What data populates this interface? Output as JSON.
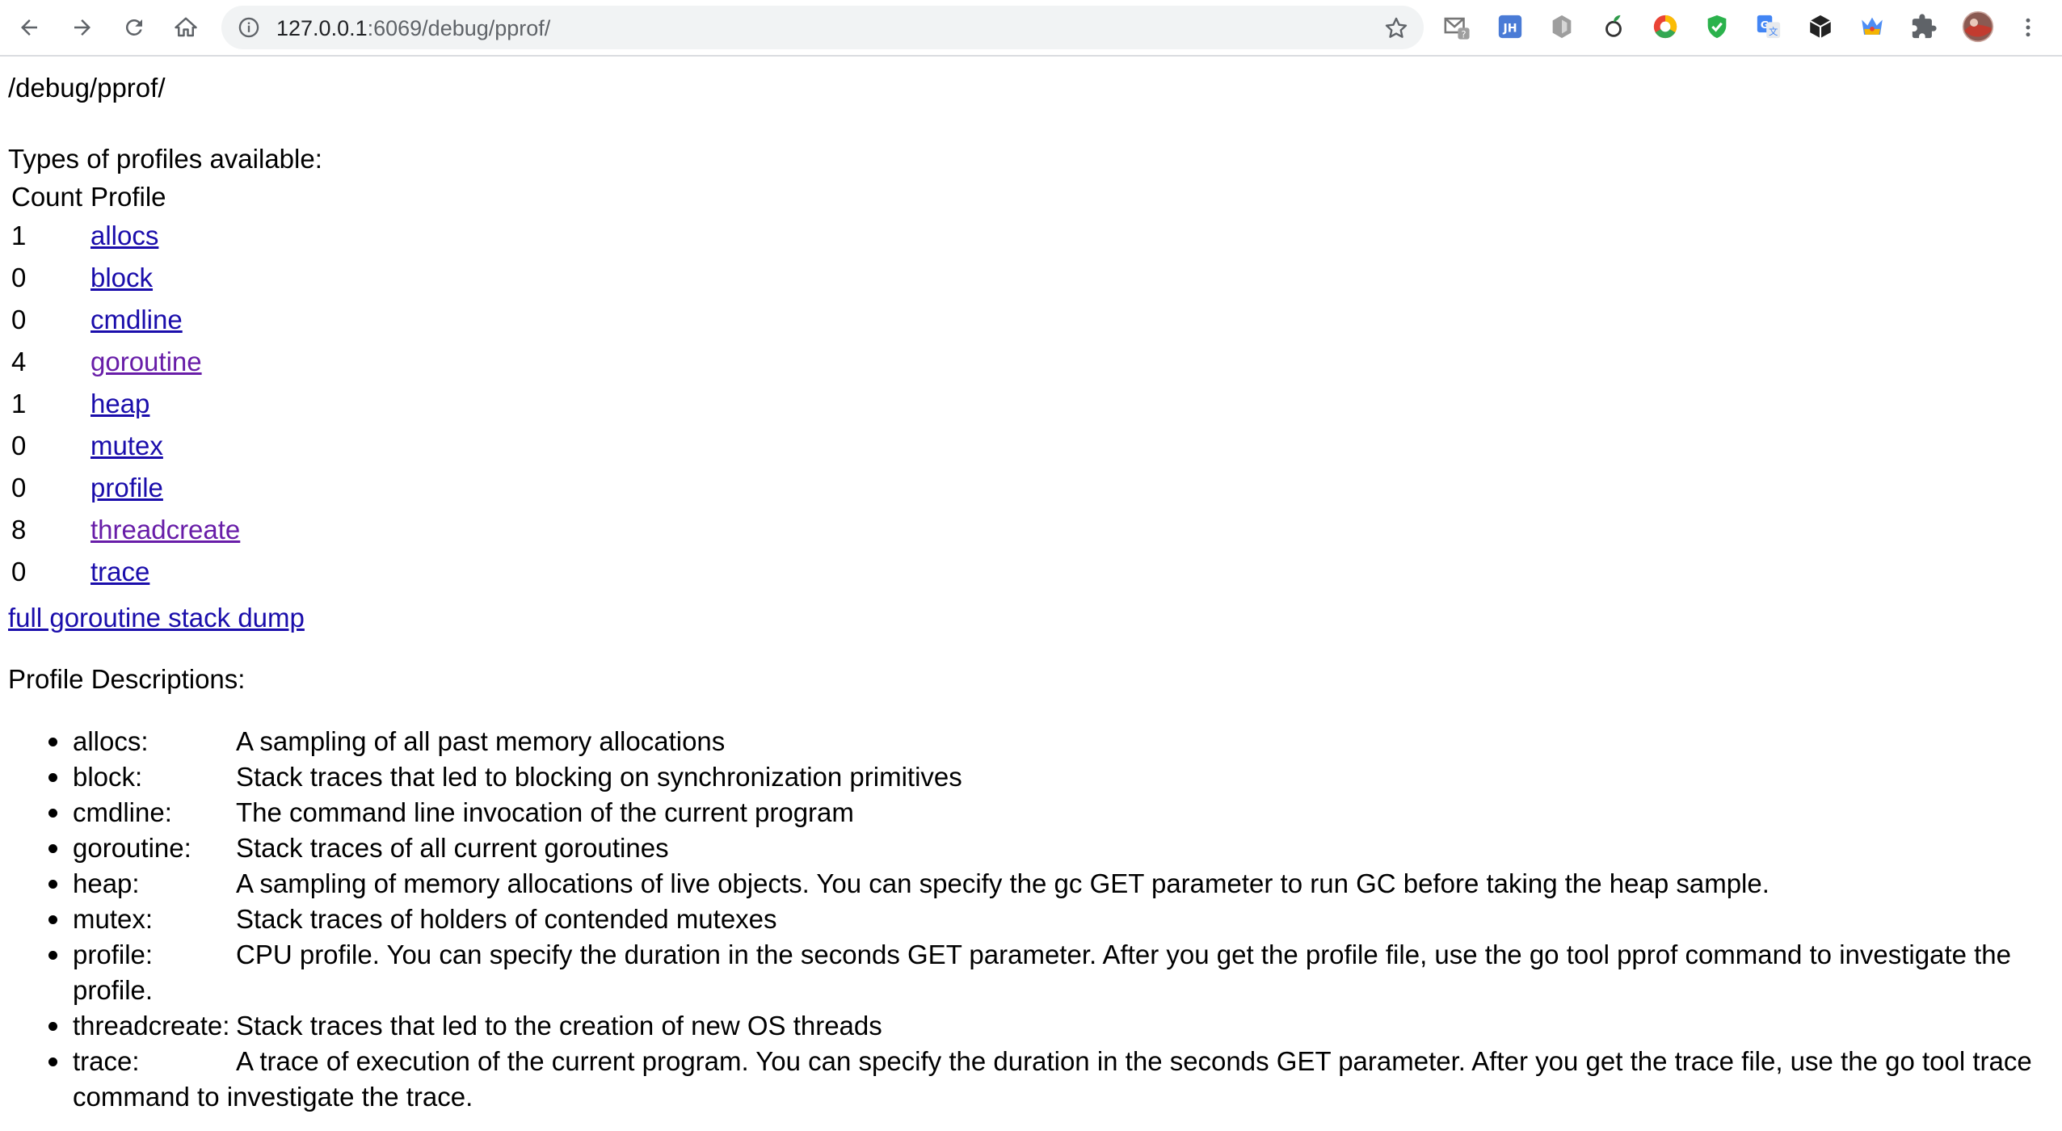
{
  "browser": {
    "url_host": "127.0.0.1",
    "url_rest": ":6069/debug/pprof/",
    "extensions": [
      "gmail-checker-icon",
      "jh-extension-icon",
      "hexagon-extension-icon",
      "leaf-extension-icon",
      "chrome-rainbow-extension-icon",
      "shield-check-icon",
      "google-translate-icon",
      "cube-extension-icon",
      "crown-extension-icon",
      "puzzle-extensions-icon",
      "profile-avatar"
    ]
  },
  "page": {
    "path_title": "/debug/pprof/",
    "types_heading": "Types of profiles available:",
    "table": {
      "headers": [
        "Count",
        "Profile"
      ],
      "rows": [
        {
          "count": "1",
          "profile": "allocs"
        },
        {
          "count": "0",
          "profile": "block"
        },
        {
          "count": "0",
          "profile": "cmdline"
        },
        {
          "count": "4",
          "profile": "goroutine"
        },
        {
          "count": "1",
          "profile": "heap"
        },
        {
          "count": "0",
          "profile": "mutex"
        },
        {
          "count": "0",
          "profile": "profile"
        },
        {
          "count": "8",
          "profile": "threadcreate"
        },
        {
          "count": "0",
          "profile": "trace"
        }
      ]
    },
    "dump_link": "full goroutine stack dump",
    "desc_heading": "Profile Descriptions:",
    "descriptions": [
      {
        "term": "allocs:",
        "text": "A sampling of all past memory allocations"
      },
      {
        "term": "block:",
        "text": "Stack traces that led to blocking on synchronization primitives"
      },
      {
        "term": "cmdline:",
        "text": "The command line invocation of the current program"
      },
      {
        "term": "goroutine:",
        "text": "Stack traces of all current goroutines"
      },
      {
        "term": "heap:",
        "text": "A sampling of memory allocations of live objects. You can specify the gc GET parameter to run GC before taking the heap sample."
      },
      {
        "term": "mutex:",
        "text": "Stack traces of holders of contended mutexes"
      },
      {
        "term": "profile:",
        "text": "CPU profile. You can specify the duration in the seconds GET parameter. After you get the profile file, use the go tool pprof command to investigate the profile."
      },
      {
        "term": "threadcreate:",
        "text": "Stack traces that led to the creation of new OS threads"
      },
      {
        "term": "trace:",
        "text": "A trace of execution of the current program. You can specify the duration in the seconds GET parameter. After you get the trace file, use the go tool trace command to investigate the trace."
      }
    ]
  }
}
